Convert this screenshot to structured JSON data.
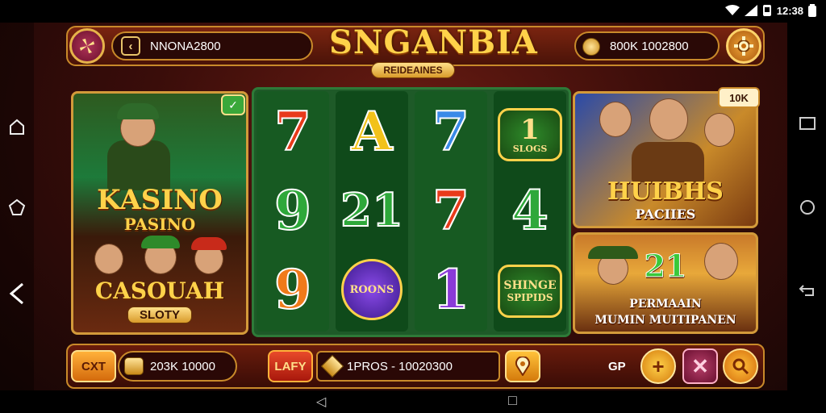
{
  "status_bar": {
    "time": "12:38",
    "icons": [
      "wifi-icon",
      "signal-icon",
      "notification-icon",
      "battery-icon"
    ]
  },
  "header": {
    "back_icon": "fan-icon",
    "player_name": "NNONA2800",
    "balance_label": "800K 1002800",
    "settings_icon": "gear-icon"
  },
  "logo": {
    "title": "SNGANBIA",
    "subtitle": "REIDEAINES"
  },
  "left_tile": {
    "badge_icon": "check-icon",
    "title": "KASINO",
    "subtitle": "PASINO",
    "banner_title": "CASOUAH",
    "banner_sub": "SLOTY"
  },
  "reels": [
    {
      "symbols": [
        {
          "text": "7",
          "color": "#e83a1a"
        },
        {
          "text": "9",
          "color": "#2ea83a"
        },
        {
          "text": "9",
          "color": "#f07a1a"
        }
      ]
    },
    {
      "symbols": [
        {
          "text": "A",
          "color": "#f2c21a"
        },
        {
          "text": "21",
          "color": "#2ea83a"
        },
        {
          "text": "ROONS",
          "color": "#ffd24a",
          "badge": true
        }
      ]
    },
    {
      "symbols": [
        {
          "text": "7",
          "color": "#3a8ae8"
        },
        {
          "text": "7",
          "color": "#e83a1a"
        },
        {
          "text": "1",
          "color": "#8a3ad8"
        }
      ]
    },
    {
      "symbols": [
        {
          "text": "1",
          "sub": "SLOGS",
          "color": "#ffd24a",
          "badge": true
        },
        {
          "text": "4",
          "color": "#2ea83a"
        },
        {
          "text": "SHINGE",
          "sub": "SPIPIDS",
          "color": "#ffd24a",
          "badge": true
        }
      ]
    }
  ],
  "right_top_tile": {
    "badge": "10K",
    "title": "HUIBHS",
    "subtitle": "PACIIES"
  },
  "right_bottom_tile": {
    "number": "21",
    "line1": "PERMAAIN",
    "line2": "MUMIN MUITIPANEN"
  },
  "bottom_bar": {
    "cxt_label": "CXT",
    "balance_value": "203K 10000",
    "lafy_label": "LAFY",
    "prize_value": "1PROS - 10020300",
    "gp_label": "GP",
    "plus_label": "+",
    "close_label": "✕"
  },
  "android_nav": {
    "back": "◁",
    "home": "○",
    "recents": "□"
  }
}
